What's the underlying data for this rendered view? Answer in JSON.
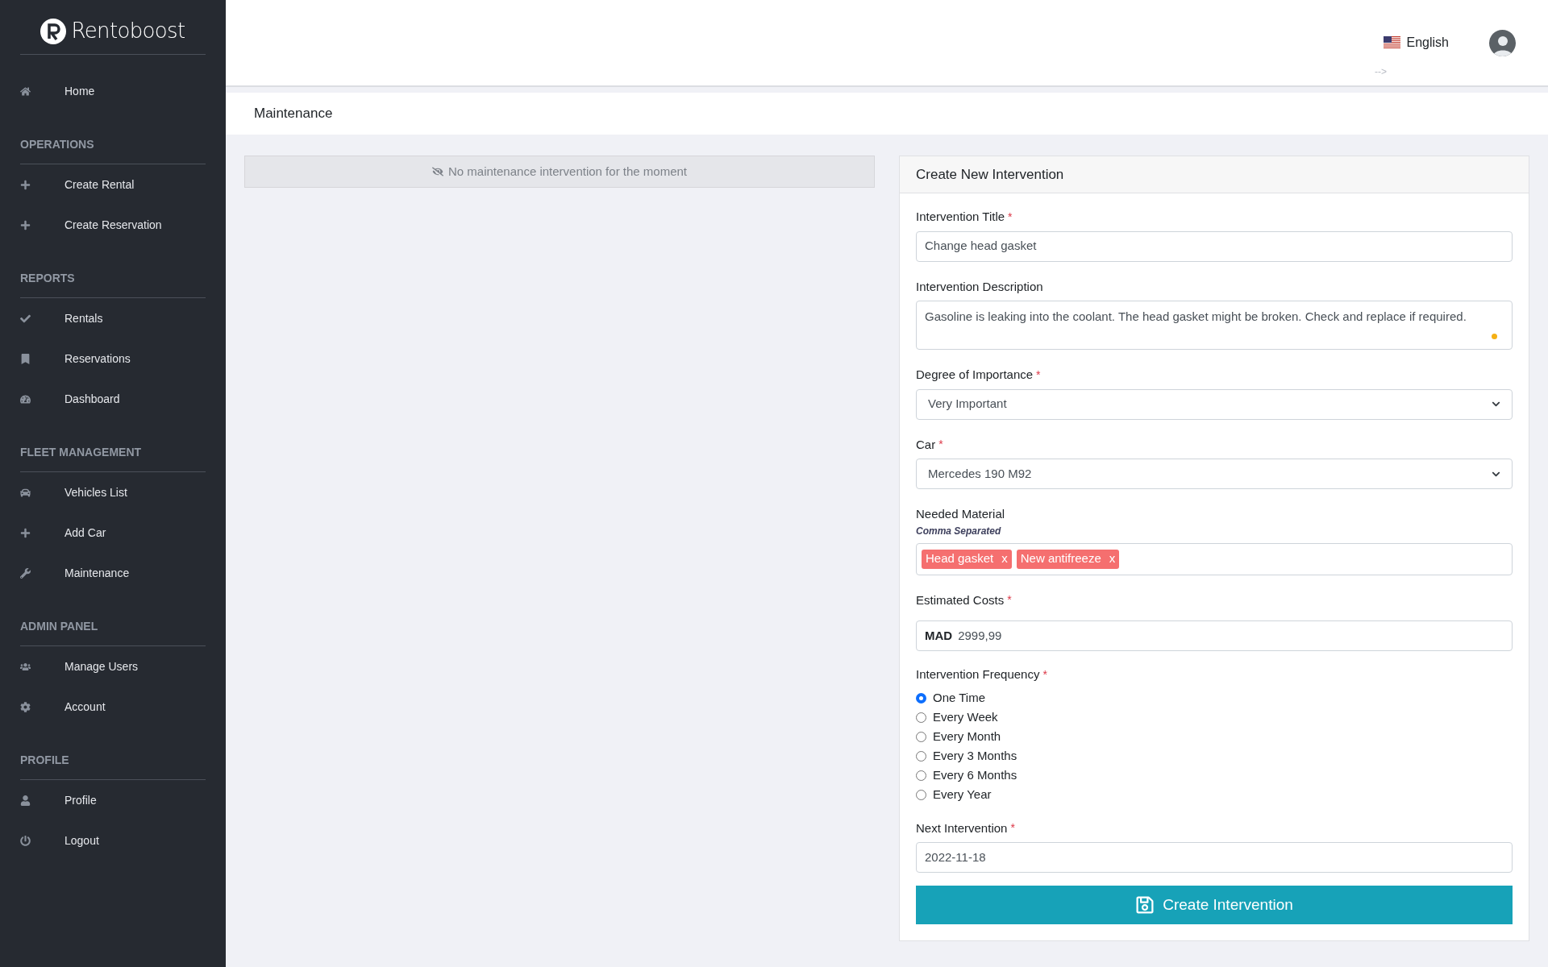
{
  "sidebar": {
    "logo": "Rentoboost",
    "home": {
      "label": "Home"
    },
    "sections": [
      {
        "title": "OPERATIONS",
        "items": [
          {
            "label": "Create Rental"
          },
          {
            "label": "Create Reservation"
          }
        ]
      },
      {
        "title": "REPORTS",
        "items": [
          {
            "label": "Rentals"
          },
          {
            "label": "Reservations"
          },
          {
            "label": "Dashboard"
          }
        ]
      },
      {
        "title": "FLEET MANAGEMENT",
        "items": [
          {
            "label": "Vehicles List"
          },
          {
            "label": "Add Car"
          },
          {
            "label": "Maintenance"
          }
        ]
      },
      {
        "title": "ADMIN PANEL",
        "items": [
          {
            "label": "Manage Users"
          },
          {
            "label": "Account"
          }
        ]
      },
      {
        "title": "PROFILE",
        "items": [
          {
            "label": "Profile"
          },
          {
            "label": "Logout"
          }
        ]
      }
    ]
  },
  "header": {
    "language": "English",
    "stray_text": "-->"
  },
  "page_title": "Maintenance",
  "empty_notice": "No maintenance intervention for the moment",
  "form": {
    "title": "Create New Intervention",
    "intervention_title": {
      "label": "Intervention Title",
      "required_mark": "*",
      "value": "Change head gasket"
    },
    "description": {
      "label": "Intervention Description",
      "value": "Gasoline is leaking into the coolant. The head gasket might be broken. Check and replace if required."
    },
    "importance": {
      "label": "Degree of Importance",
      "required_mark": "*",
      "value": "Very Important"
    },
    "car": {
      "label": "Car",
      "required_mark": "*",
      "value": "Mercedes 190 M92"
    },
    "material": {
      "label": "Needed Material",
      "hint": "Comma Separated",
      "tags": [
        {
          "label": "Head gasket",
          "remove": "x"
        },
        {
          "label": "New antifreeze",
          "remove": "x"
        }
      ]
    },
    "costs": {
      "label": "Estimated Costs",
      "required_mark": "*",
      "currency": "MAD",
      "value": "2999,99"
    },
    "frequency": {
      "label": "Intervention Frequency",
      "required_mark": "*",
      "options": [
        {
          "label": "One Time",
          "selected": true
        },
        {
          "label": "Every Week",
          "selected": false
        },
        {
          "label": "Every Month",
          "selected": false
        },
        {
          "label": "Every 3 Months",
          "selected": false
        },
        {
          "label": "Every 6 Months",
          "selected": false
        },
        {
          "label": "Every Year",
          "selected": false
        }
      ]
    },
    "next": {
      "label": "Next Intervention",
      "required_mark": "*",
      "value": "2022-11-18"
    },
    "submit": "Create Intervention"
  }
}
